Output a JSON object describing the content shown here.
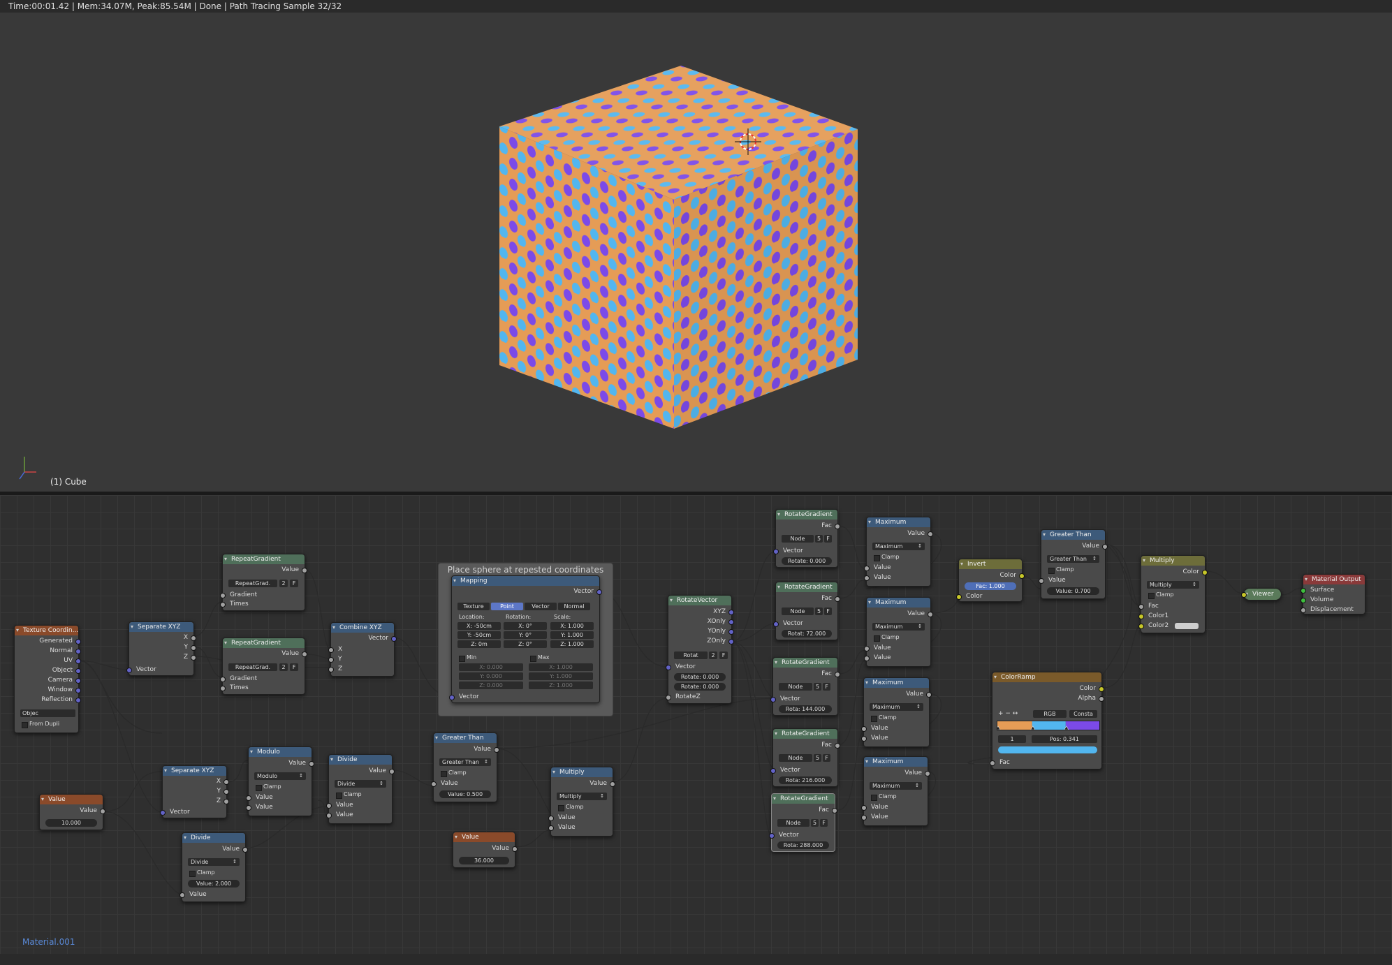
{
  "status": {
    "text": "Time:00:01.42 | Mem:34.07M, Peak:85.54M | Done | Path Tracing Sample 32/32"
  },
  "viewport": {
    "object_label": "(1) Cube",
    "colors": {
      "base": "#e59c56",
      "spot_a": "#52b6ef",
      "spot_b": "#7b4ae8"
    }
  },
  "editor": {
    "material_label": "Material.001"
  },
  "frame": {
    "title": "Place sphere at repested coordinates"
  },
  "nodes": {
    "texcoord": {
      "title": "Texture Coordin...",
      "outputs": [
        "Generated",
        "Normal",
        "UV",
        "Object",
        "Camera",
        "Window",
        "Reflection"
      ],
      "object_label": "Objec",
      "from_dupli": "From Dupli"
    },
    "sepxyz1": {
      "title": "Separate XYZ",
      "outputs": [
        "X",
        "Y",
        "Z"
      ],
      "input": "Vector"
    },
    "repgrad1": {
      "title": "RepeatGradient",
      "output": "Value",
      "node_label": "RepeatGrad.",
      "node_num": "2",
      "flag": "F",
      "inputs": [
        "Gradient",
        "Times"
      ]
    },
    "repgrad2": {
      "title": "RepeatGradient",
      "output": "Value",
      "node_label": "RepeatGrad.",
      "node_num": "2",
      "flag": "F",
      "inputs": [
        "Gradient",
        "Times"
      ]
    },
    "combxyz": {
      "title": "Combine XYZ",
      "output": "Vector",
      "inputs": [
        "X",
        "Y",
        "Z"
      ]
    },
    "mapping": {
      "title": "Mapping",
      "output": "Vector",
      "tabs": [
        "Texture",
        "Point",
        "Vector",
        "Normal"
      ],
      "active_tab": "Point",
      "loc_label": "Location:",
      "rot_label": "Rotation:",
      "scale_label": "Scale:",
      "loc": [
        "X:  -50cm",
        "Y:  -50cm",
        "Z:  0m"
      ],
      "rot": [
        "X:  0°",
        "Y:  0°",
        "Z:  0°"
      ],
      "scale": [
        "X:  1.000",
        "Y:  1.000",
        "Z:  1.000"
      ],
      "min_label": "Min",
      "max_label": "Max",
      "min": [
        "X:  0.000",
        "Y:  0.000",
        "Z:  0.000"
      ],
      "max": [
        "X:  1.000",
        "Y:  1.000",
        "Z:  1.000"
      ],
      "input": "Vector"
    },
    "rotvec": {
      "title": "RotateVector",
      "outputs": [
        "XYZ",
        "XOnly",
        "YOnly",
        "ZOnly"
      ],
      "node_label": "Rotat",
      "node_num": "2",
      "flag": "F",
      "inputs": [
        "Vector"
      ],
      "fields": [
        "Rotate:  0.000",
        "Rotate:  0.000"
      ],
      "rotz": "RotateZ"
    },
    "rg1": {
      "title": "RotateGradient",
      "output": "Fac",
      "node_label": "Node",
      "node_num": "5",
      "flag": "F",
      "input": "Vector",
      "field": "Rotate:  0.000"
    },
    "rg2": {
      "title": "RotateGradient",
      "output": "Fac",
      "node_label": "Node",
      "node_num": "5",
      "flag": "F",
      "input": "Vector",
      "field": "Rotat:  72.000"
    },
    "rg3": {
      "title": "RotateGradient",
      "output": "Fac",
      "node_label": "Node",
      "node_num": "5",
      "flag": "F",
      "input": "Vector",
      "field": "Rota:  144.000"
    },
    "rg4": {
      "title": "RotateGradient",
      "output": "Fac",
      "node_label": "Node",
      "node_num": "5",
      "flag": "F",
      "input": "Vector",
      "field": "Rota:  216.000"
    },
    "rg5": {
      "title": "RotateGradient",
      "output": "Fac",
      "node_label": "Node",
      "node_num": "5",
      "flag": "F",
      "input": "Vector",
      "field": "Rota:  288.000"
    },
    "max1": {
      "title": "Maximum",
      "output": "Value",
      "op": "Maximum",
      "clamp": "Clamp",
      "inputs": [
        "Value",
        "Value"
      ]
    },
    "max2": {
      "title": "Maximum",
      "output": "Value",
      "op": "Maximum",
      "clamp": "Clamp",
      "inputs": [
        "Value",
        "Value"
      ]
    },
    "max3": {
      "title": "Maximum",
      "output": "Value",
      "op": "Maximum",
      "clamp": "Clamp",
      "inputs": [
        "Value",
        "Value"
      ]
    },
    "max4": {
      "title": "Maximum",
      "output": "Value",
      "op": "Maximum",
      "clamp": "Clamp",
      "inputs": [
        "Value",
        "Value"
      ]
    },
    "invert": {
      "title": "Invert",
      "output": "Color",
      "fac": "Fac:  1.000",
      "input": "Color"
    },
    "gt2": {
      "title": "Greater Than",
      "output": "Value",
      "op": "Greater Than",
      "clamp": "Clamp",
      "input": "Value",
      "field": "Value:  0.700"
    },
    "multiply2": {
      "title": "Multiply",
      "output": "Color",
      "op": "Multiply",
      "clamp": "Clamp",
      "inputs": [
        "Fac",
        "Color1",
        "Color2"
      ]
    },
    "viewer": {
      "title": "Viewer"
    },
    "matout": {
      "title": "Material Output",
      "inputs": [
        "Surface",
        "Volume",
        "Displacement"
      ]
    },
    "colorramp": {
      "title": "ColorRamp",
      "outputs": [
        "Color",
        "Alpha"
      ],
      "mode": "RGB",
      "interp": "Consta",
      "index": "1",
      "pos": "Pos:  0.341",
      "input": "Fac",
      "tools": "+  −  ↔",
      "stops": [
        {
          "pos": 0.0,
          "color": "#e59c56"
        },
        {
          "pos": 0.341,
          "color": "#52b6ef"
        },
        {
          "pos": 0.67,
          "color": "#7b4ae8"
        }
      ]
    },
    "value1": {
      "title": "Value",
      "output": "Value",
      "field": "10.000"
    },
    "sepxyz2": {
      "title": "Separate XYZ",
      "outputs": [
        "X",
        "Y",
        "Z"
      ],
      "input": "Vector"
    },
    "modulo": {
      "title": "Modulo",
      "output": "Value",
      "op": "Modulo",
      "clamp": "Clamp",
      "inputs": [
        "Value",
        "Value"
      ]
    },
    "divide1": {
      "title": "Divide",
      "output": "Value",
      "op": "Divide",
      "clamp": "Clamp",
      "inputs": [
        "Value",
        "Value"
      ]
    },
    "divide2": {
      "title": "Divide",
      "output": "Value",
      "op": "Divide",
      "clamp": "Clamp",
      "field": "Value:  2.000",
      "input": "Value"
    },
    "gt1": {
      "title": "Greater Than",
      "output": "Value",
      "op": "Greater Than",
      "clamp": "Clamp",
      "input": "Value",
      "field": "Value:  0.500"
    },
    "multiply1": {
      "title": "Multiply",
      "output": "Value",
      "op": "Multiply",
      "clamp": "Clamp",
      "inputs": [
        "Value",
        "Value"
      ]
    },
    "value2": {
      "title": "Value",
      "output": "Value",
      "field": "36.000"
    }
  }
}
